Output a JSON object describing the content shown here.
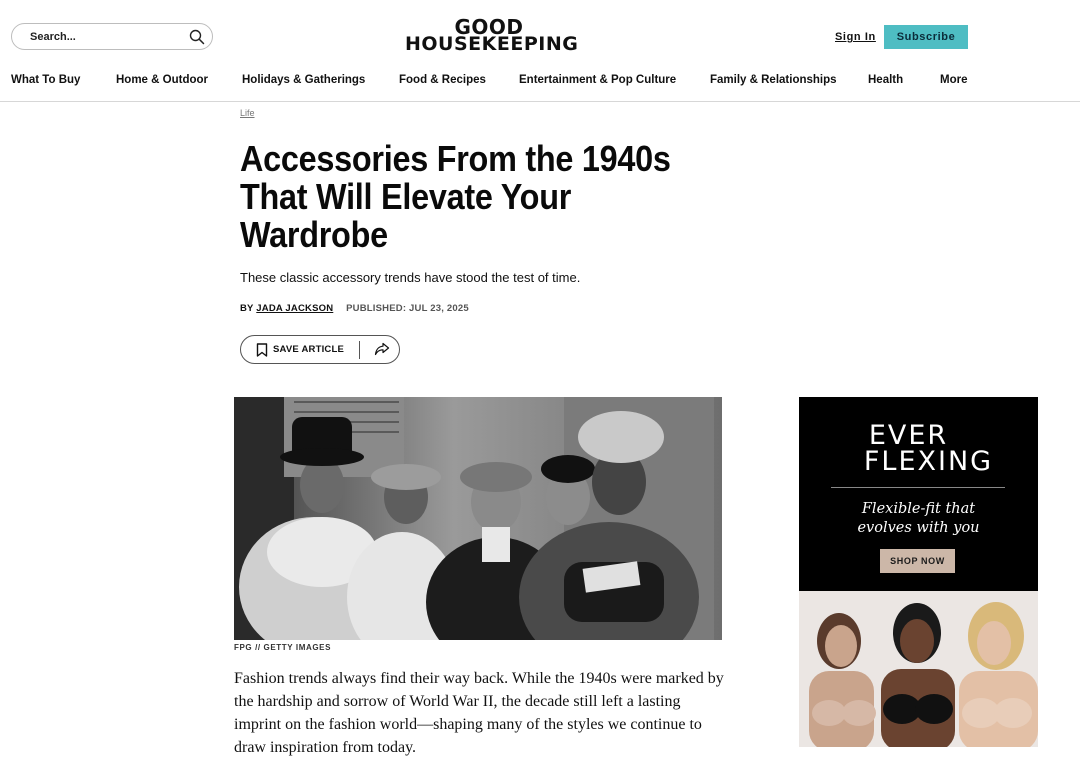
{
  "header": {
    "search": {
      "placeholder": "Search...",
      "value": ""
    },
    "logo_line1": "GOOD",
    "logo_line2": "HOUSEKEEPING",
    "sign_in": "Sign In",
    "subscribe": "Subscribe"
  },
  "nav": {
    "items": [
      "What To Buy",
      "Home & Outdoor",
      "Holidays & Gatherings",
      "Food & Recipes",
      "Entertainment & Pop Culture",
      "Family & Relationships",
      "Health",
      "More"
    ]
  },
  "article": {
    "category": "Life",
    "headline": "Accessories From the 1940s That Will Elevate Your Wardrobe",
    "dek": "These classic accessory trends have stood the test of time.",
    "by": "BY",
    "author": "JADA JACKSON",
    "published": "PUBLISHED: JUL 23, 2025",
    "save_label": "SAVE ARTICLE",
    "image_credit": "FPG  // GETTY IMAGES",
    "body": "Fashion trends always find their way back. While the 1940s were marked by the hardship and sorrow of World War II, the decade still left a lasting imprint on the fashion world—shaping many of the styles we continue to draw inspiration from today."
  },
  "ad": {
    "brand_line1": "EVER",
    "brand_line2": "FLEXING",
    "tagline_line1": "Flexible-fit that",
    "tagline_line2": "evolves with you",
    "cta": "SHOP NOW"
  },
  "icons": {
    "search": "search-icon",
    "bookmark": "bookmark-icon",
    "share": "share-icon"
  },
  "colors": {
    "subscribe_bg": "#4ebdc3",
    "ad_cta_bg": "#ccb7a8"
  }
}
